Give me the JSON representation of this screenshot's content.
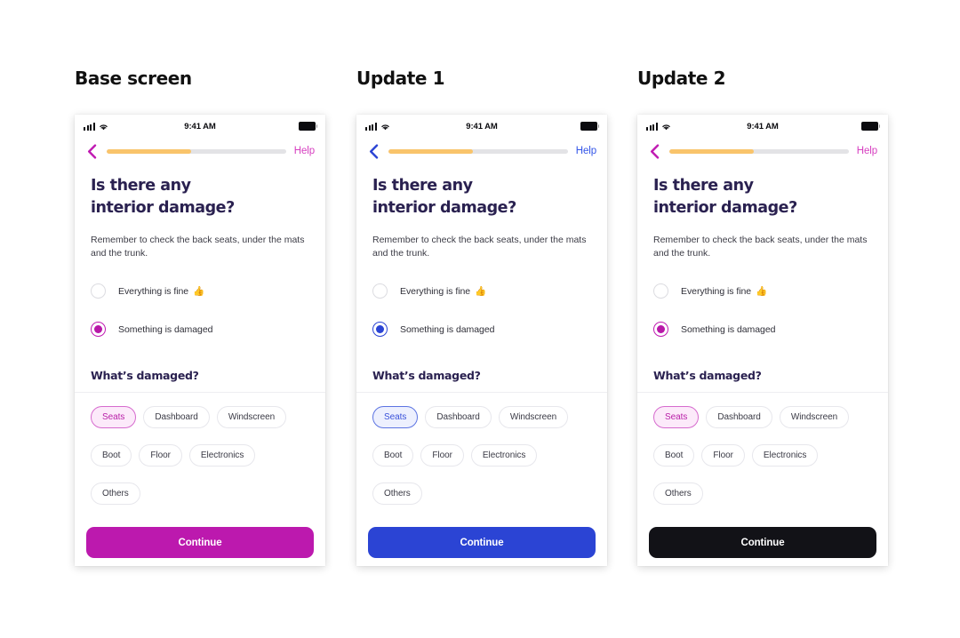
{
  "columns": [
    {
      "title": "Base screen",
      "theme": {
        "accent": "#C01BB2",
        "back_arrow": "#C01BB2",
        "help": "#D63FC0",
        "radio_border_on": "#C01BB2",
        "radio_dot": "#B818A8",
        "chip_selected_bg": "#FCEAFA",
        "chip_selected_border": "#D66BCE",
        "chip_selected_text": "#B81FA8",
        "cta_bg": "#BC19AE",
        "progress_fill": "#F9C46B",
        "progress_track": "#E3E3E6"
      },
      "status_bar": {
        "time": "9:41 AM"
      },
      "nav": {
        "help_label": "Help",
        "progress_percent": 47
      },
      "content": {
        "title": "Is there any\ninterior damage?",
        "subtitle": "Remember to check the back seats, under the mats and the trunk.",
        "options": [
          {
            "label": "Everything is fine",
            "emoji": "👍",
            "selected": false
          },
          {
            "label": "Something is damaged",
            "emoji": "",
            "selected": true
          }
        ],
        "section_title": "What’s damaged?",
        "chips": [
          {
            "label": "Seats",
            "selected": true
          },
          {
            "label": "Dashboard",
            "selected": false
          },
          {
            "label": "Windscreen",
            "selected": false
          },
          {
            "label": "Boot",
            "selected": false
          },
          {
            "label": "Floor",
            "selected": false
          },
          {
            "label": "Electronics",
            "selected": false
          },
          {
            "label": "Others",
            "selected": false
          }
        ],
        "cta_label": "Continue"
      }
    },
    {
      "title": "Update 1",
      "theme": {
        "accent": "#2B44D4",
        "back_arrow": "#2B44D4",
        "help": "#3355E8",
        "radio_border_on": "#2B44D4",
        "radio_dot": "#2B44D4",
        "chip_selected_bg": "#EDF0FE",
        "chip_selected_border": "#5C74E2",
        "chip_selected_text": "#3A52DA",
        "cta_bg": "#2B44D4",
        "progress_fill": "#F9C46B",
        "progress_track": "#E3E3E6"
      },
      "status_bar": {
        "time": "9:41 AM"
      },
      "nav": {
        "help_label": "Help",
        "progress_percent": 47
      },
      "content": {
        "title": "Is there any\ninterior damage?",
        "subtitle": "Remember to check the back seats, under the mats and the trunk.",
        "options": [
          {
            "label": "Everything is fine",
            "emoji": "👍",
            "selected": false
          },
          {
            "label": "Something is damaged",
            "emoji": "",
            "selected": true
          }
        ],
        "section_title": "What’s damaged?",
        "chips": [
          {
            "label": "Seats",
            "selected": true
          },
          {
            "label": "Dashboard",
            "selected": false
          },
          {
            "label": "Windscreen",
            "selected": false
          },
          {
            "label": "Boot",
            "selected": false
          },
          {
            "label": "Floor",
            "selected": false
          },
          {
            "label": "Electronics",
            "selected": false
          },
          {
            "label": "Others",
            "selected": false
          }
        ],
        "cta_label": "Continue"
      }
    },
    {
      "title": "Update 2",
      "theme": {
        "accent": "#C01BB2",
        "back_arrow": "#C01BB2",
        "help": "#D63FC0",
        "radio_border_on": "#C01BB2",
        "radio_dot": "#B818A8",
        "chip_selected_bg": "#FCEAFA",
        "chip_selected_border": "#D66BCE",
        "chip_selected_text": "#B81FA8",
        "cta_bg": "#121217",
        "progress_fill": "#F9C46B",
        "progress_track": "#E3E3E6"
      },
      "status_bar": {
        "time": "9:41 AM"
      },
      "nav": {
        "help_label": "Help",
        "progress_percent": 47
      },
      "content": {
        "title": "Is there any\ninterior damage?",
        "subtitle": "Remember to check the back seats, under the mats and the trunk.",
        "options": [
          {
            "label": "Everything is fine",
            "emoji": "👍",
            "selected": false
          },
          {
            "label": "Something is damaged",
            "emoji": "",
            "selected": true
          }
        ],
        "section_title": "What’s damaged?",
        "chips": [
          {
            "label": "Seats",
            "selected": true
          },
          {
            "label": "Dashboard",
            "selected": false
          },
          {
            "label": "Windscreen",
            "selected": false
          },
          {
            "label": "Boot",
            "selected": false
          },
          {
            "label": "Floor",
            "selected": false
          },
          {
            "label": "Electronics",
            "selected": false
          },
          {
            "label": "Others",
            "selected": false
          }
        ],
        "cta_label": "Continue"
      }
    }
  ]
}
